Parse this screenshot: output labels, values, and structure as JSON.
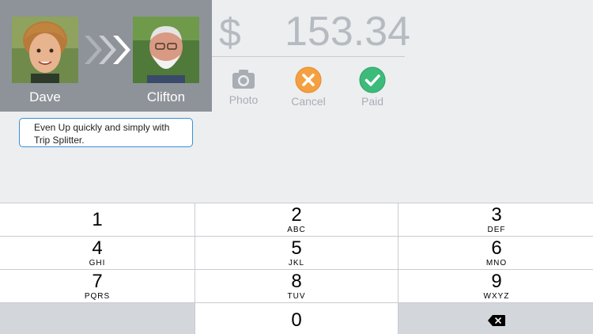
{
  "transfer": {
    "from_name": "Dave",
    "to_name": "Clifton"
  },
  "amount": {
    "currency_symbol": "$",
    "value": "153.34"
  },
  "actions": {
    "photo_label": "Photo",
    "cancel_label": "Cancel",
    "paid_label": "Paid"
  },
  "tooltip": {
    "text": "Even Up quickly and simply with Trip Splitter."
  },
  "keypad": {
    "keys": [
      {
        "digit": "1",
        "letters": ""
      },
      {
        "digit": "2",
        "letters": "ABC"
      },
      {
        "digit": "3",
        "letters": "DEF"
      },
      {
        "digit": "4",
        "letters": "GHI"
      },
      {
        "digit": "5",
        "letters": "JKL"
      },
      {
        "digit": "6",
        "letters": "MNO"
      },
      {
        "digit": "7",
        "letters": "PQRS"
      },
      {
        "digit": "8",
        "letters": "TUV"
      },
      {
        "digit": "9",
        "letters": "WXYZ"
      },
      {
        "digit": "0",
        "letters": ""
      }
    ],
    "delete_icon": "backspace-icon"
  },
  "colors": {
    "panel_bg": "#8e9399",
    "cancel_orange": "#f5a040",
    "paid_green": "#3dbb7a",
    "tooltip_border": "#3a8fd6",
    "amount_text": "#b6bbc2"
  }
}
